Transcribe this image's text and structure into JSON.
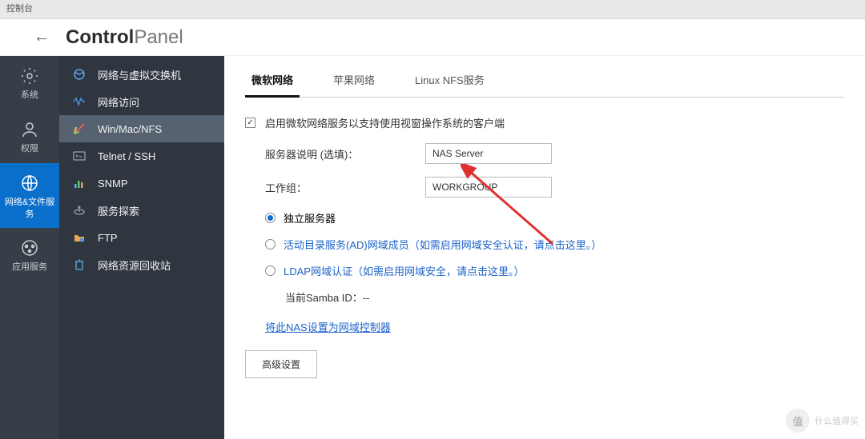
{
  "titlebar": "控制台",
  "breadcrumb": {
    "bold": "Control",
    "light": "Panel"
  },
  "nav": {
    "items": [
      {
        "label": "系统"
      },
      {
        "label": "权限"
      },
      {
        "label": "网络&文件服务"
      },
      {
        "label": "应用服务"
      }
    ]
  },
  "sidebar": {
    "items": [
      {
        "label": "网络与虚拟交换机"
      },
      {
        "label": "网络访问"
      },
      {
        "label": "Win/Mac/NFS"
      },
      {
        "label": "Telnet / SSH"
      },
      {
        "label": "SNMP"
      },
      {
        "label": "服务探索"
      },
      {
        "label": "FTP"
      },
      {
        "label": "网络资源回收站"
      }
    ]
  },
  "tabs": [
    "微软网络",
    "苹果网络",
    "Linux NFS服务"
  ],
  "form": {
    "enable_label": "启用微软网络服务以支持使用视窗操作系统的客户端",
    "server_desc_label": "服务器说明 (选填)：",
    "server_desc_value": "NAS Server",
    "workgroup_label": "工作组：",
    "workgroup_value": "WORKGROUP",
    "radio_standalone": "独立服务器",
    "radio_ad": "活动目录服务(AD)网域成员（如需启用网域安全认证，请点击这里。）",
    "radio_ldap": "LDAP网域认证（如需启用网域安全，请点击这里。）",
    "samba_label": "当前Samba ID：--",
    "domain_ctrl_link": "将此NAS设置为网域控制器",
    "adv_btn": "高级设置"
  },
  "watermark": {
    "brand": "值",
    "text": "什么值得买"
  }
}
